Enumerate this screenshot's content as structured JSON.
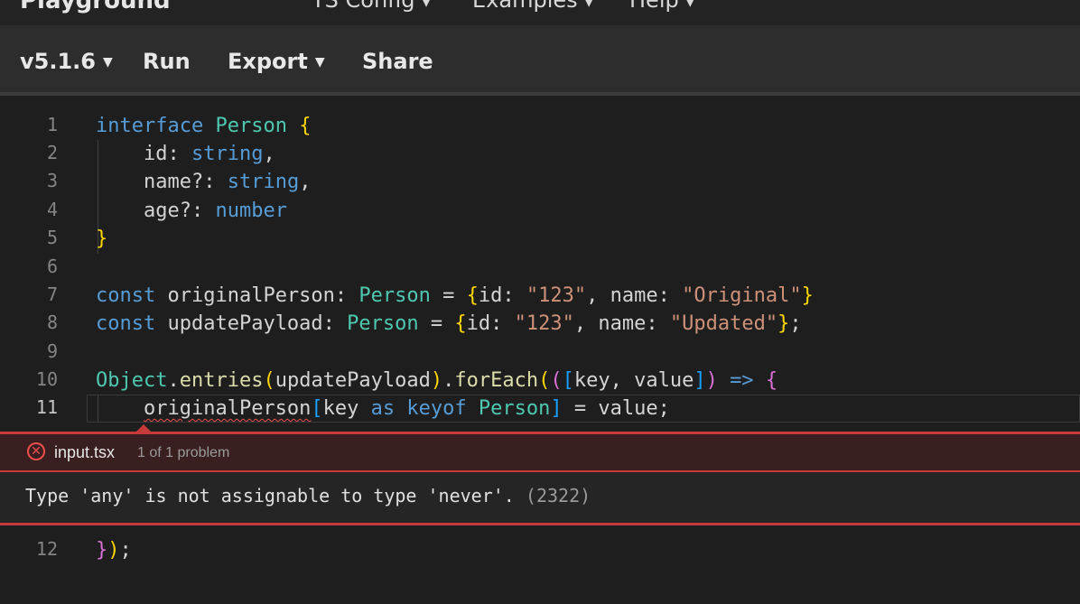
{
  "topnav": {
    "brand": "Playground",
    "menu": [
      "TS Config",
      "Examples",
      "Help"
    ]
  },
  "toolbar": {
    "version": "v5.1.6",
    "run": "Run",
    "export": "Export",
    "share": "Share"
  },
  "editor": {
    "line_numbers": [
      "1",
      "2",
      "3",
      "4",
      "5",
      "6",
      "7",
      "8",
      "9",
      "10",
      "11",
      "12"
    ],
    "l1": {
      "kw": "interface",
      "name": "Person",
      "brace": "{"
    },
    "l2": {
      "prop": "id:",
      "type": "string",
      "punct": ","
    },
    "l3": {
      "prop": "name?:",
      "type": "string",
      "punct": ","
    },
    "l4": {
      "prop": "age?:",
      "type": "number"
    },
    "l5": {
      "brace": "}"
    },
    "l7": {
      "kw": "const",
      "name": "originalPerson:",
      "type": "Person",
      "eq": "=",
      "ob": "{",
      "k1": "id:",
      "v1": "\"123\"",
      "sep": ",",
      "k2": "name:",
      "v2": "\"Original\"",
      "cb": "}"
    },
    "l8": {
      "kw": "const",
      "name": "updatePayload:",
      "type": "Person",
      "eq": "=",
      "ob": "{",
      "k1": "id:",
      "v1": "\"123\"",
      "sep": ",",
      "k2": "name:",
      "v2": "\"Updated\"",
      "cb": "}",
      "end": ";"
    },
    "l10": {
      "obj": "Object",
      "dot": ".",
      "fn": "entries",
      "p1": "(",
      "arg": "updatePayload",
      "p2": ")",
      "dot2": ".",
      "fn2": "forEach",
      "p3": "(",
      "p4": "(",
      "b1": "[",
      "params": "key, value",
      "b2": "]",
      "p5": ")",
      "arrow": "=>",
      "ob": "{"
    },
    "l11": {
      "target": "originalPerson",
      "b1": "[",
      "key": "key",
      "as": "as",
      "keyof": "keyof",
      "type": "Person",
      "b2": "]",
      "rest": "= value;"
    },
    "l12": {
      "cb": "}",
      "p": ")",
      "end": ";"
    }
  },
  "problem": {
    "file": "input.tsx",
    "count": "1 of 1 problem",
    "message": "Type 'any' is not assignable to type 'never'.",
    "code": "(2322)"
  },
  "colors": {
    "error": "#f14c4c",
    "keyword": "#569cd6",
    "type": "#4ec9b0",
    "string": "#ce9178"
  }
}
